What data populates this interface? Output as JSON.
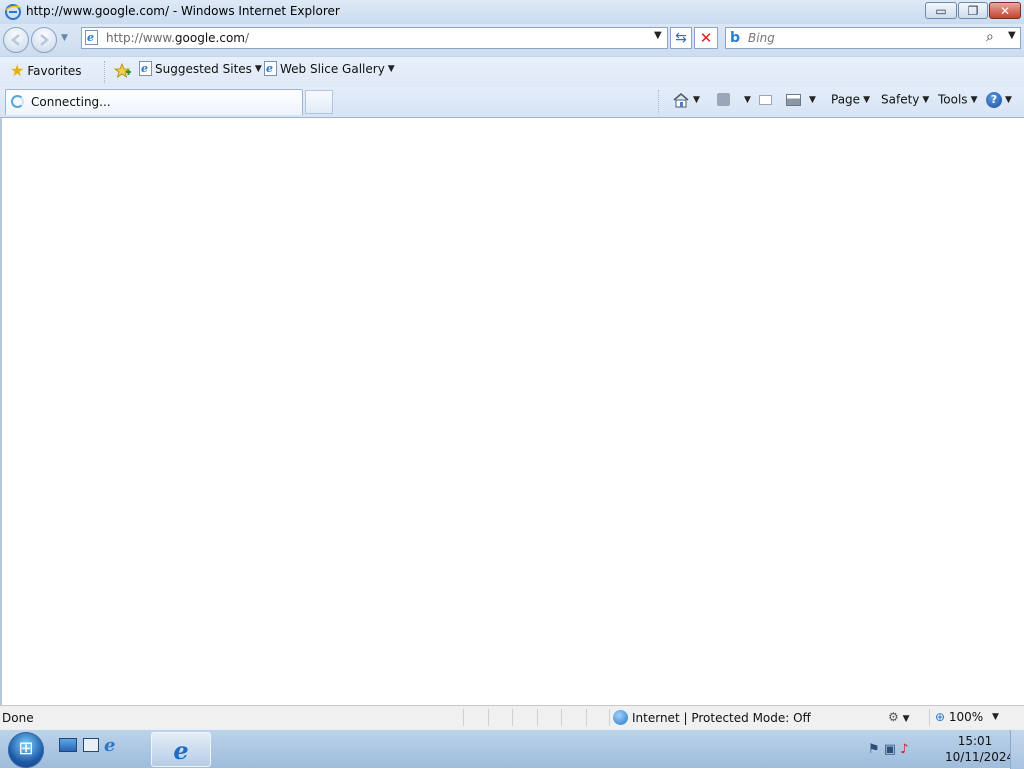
{
  "window": {
    "title": "http://www.google.com/ - Windows Internet Explorer",
    "controls": {
      "minimize": "▭",
      "maximize": "❐",
      "close": "✕"
    }
  },
  "navbar": {
    "address_prefix": "http://www.",
    "address_host": "google.com",
    "address_suffix": "/",
    "search_placeholder": "Bing",
    "search_value": ""
  },
  "favorites_bar": {
    "favorites_label": "Favorites",
    "items": [
      {
        "label": "Suggested Sites"
      },
      {
        "label": "Web Slice Gallery"
      }
    ]
  },
  "tab": {
    "label": "Connecting..."
  },
  "command_bar": {
    "page_label": "Page",
    "safety_label": "Safety",
    "tools_label": "Tools",
    "help_glyph": "?"
  },
  "status_bar": {
    "status": "Done",
    "zone": "Internet | Protected Mode: Off",
    "zoom": "100%"
  },
  "taskbar": {
    "time": "15:01",
    "date": "10/11/2024"
  },
  "colors": {
    "chrome_blue": "#cddcef",
    "close_red": "#c2432f",
    "stop_red": "#dd2222",
    "ie_blue": "#2a78c7"
  },
  "icons": [
    "ie-logo-icon",
    "back-arrow-icon",
    "forward-arrow-icon",
    "page-icon",
    "refresh-icon",
    "stop-icon",
    "bing-icon",
    "search-icon",
    "star-icon",
    "add-favorite-icon",
    "home-icon",
    "feeds-icon",
    "mail-icon",
    "print-icon",
    "help-icon",
    "globe-icon",
    "security-icon",
    "zoom-icon",
    "start-orb-icon",
    "show-desktop-icon"
  ]
}
